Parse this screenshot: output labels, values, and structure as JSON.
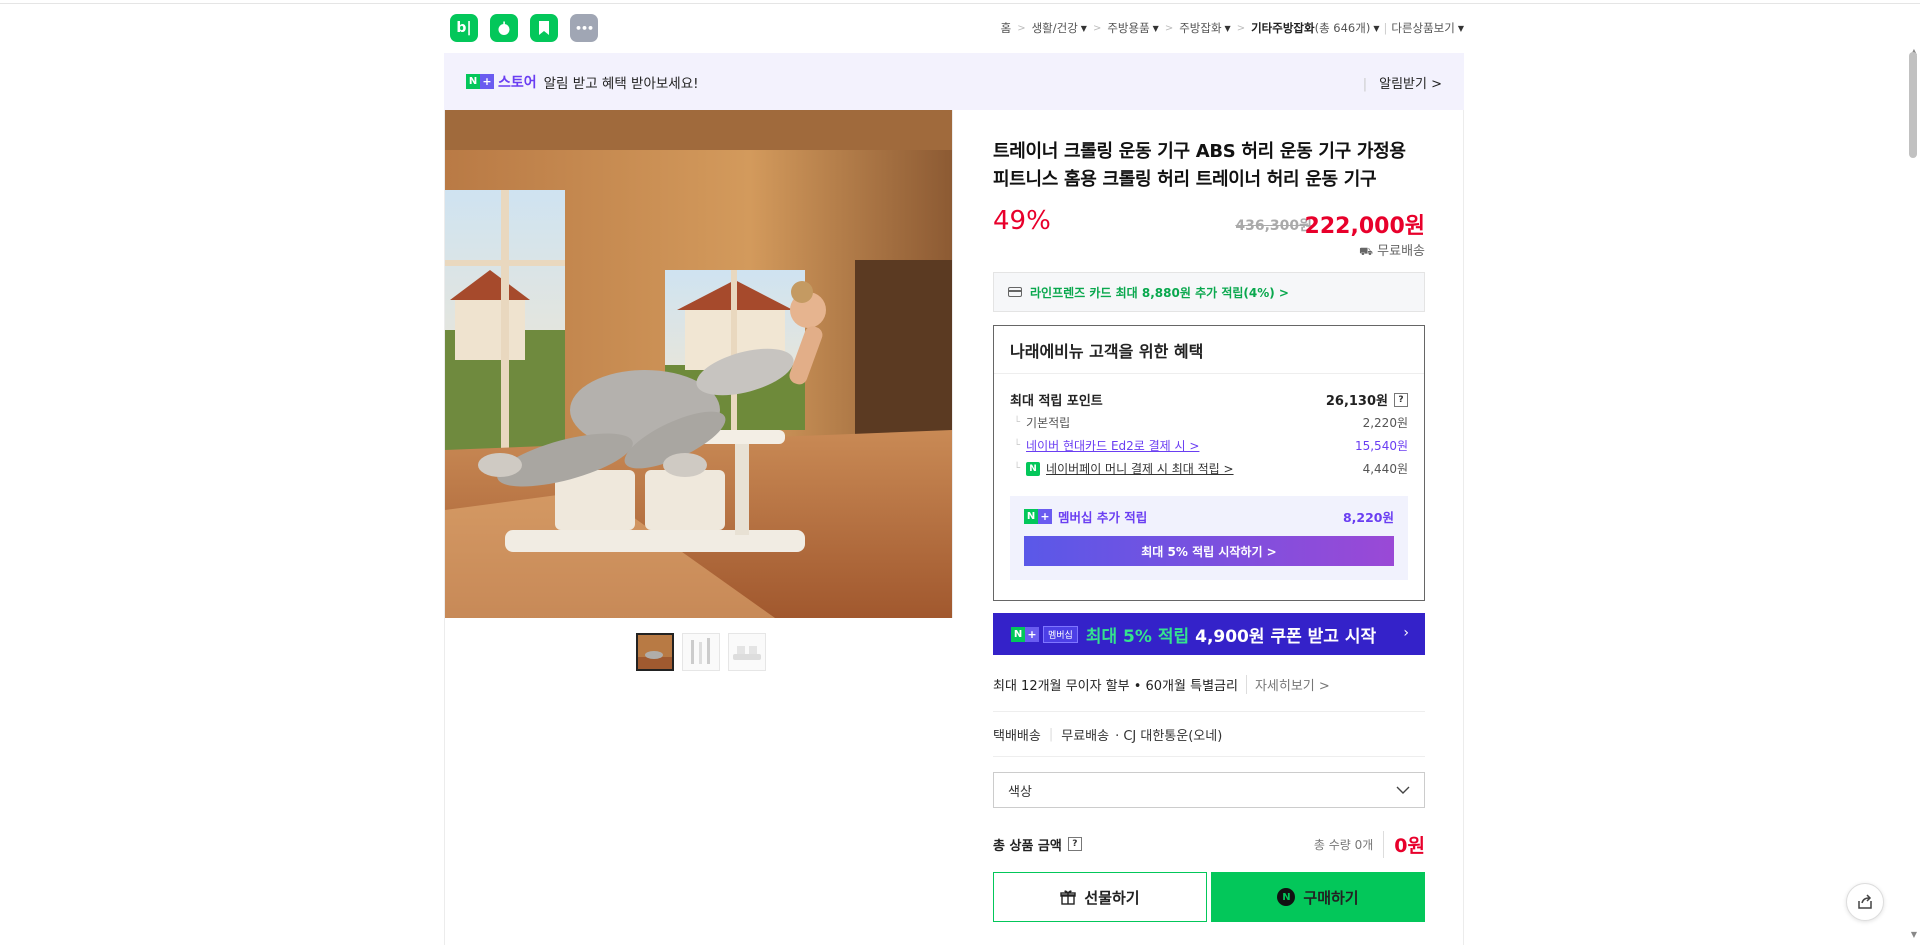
{
  "header": {
    "apps": [
      {
        "name": "blog-app-icon",
        "glyph": "b|"
      },
      {
        "name": "apple-app-icon",
        "glyph": "🍏"
      },
      {
        "name": "bookmark-app-icon",
        "glyph": "▰"
      },
      {
        "name": "more-app-icon",
        "glyph": "•••"
      }
    ],
    "breadcrumb": {
      "home": "홈",
      "level1": "생활/건강",
      "level2": "주방용품",
      "level3": "주방잡화",
      "level4": "기타주방잡화",
      "level4_count": "(총 646개)",
      "other": "다른상품보기"
    }
  },
  "store_banner": {
    "store_word": "스토어",
    "message": "알림 받고 혜택 받아보세요!",
    "alarm_label": "알림받기 >"
  },
  "product": {
    "title": "트레이너 크롤링 운동 기구 ABS 허리 운동 기구 가정용 피트니스 홈용 크롤링 허리 트레이너 허리 운동 기구",
    "discount": "49%",
    "original_price": "436,300원",
    "sale_price": "222,000원",
    "shipping": "무료배송",
    "card_benefit": "라인프렌즈 카드 최대 8,880원 추가 적립(4%) >"
  },
  "benefit": {
    "heading": "나래에비뉴 고객을 위한 혜택",
    "max_point_label": "최대 적립 포인트",
    "max_point_value": "26,130원",
    "rows": [
      {
        "label": "기본적립",
        "value": "2,220원"
      },
      {
        "label": "네이버 현대카드 Ed2로 결제 시 >",
        "value": "15,540원"
      },
      {
        "label": "네이버페이 머니 결제 시 최대 적립 >",
        "value": "4,440원"
      }
    ],
    "membership_label": "멤버십 추가 적립",
    "membership_value": "8,220원",
    "membership_button": "최대 5% 적립 시작하기 >"
  },
  "coupon": {
    "tag": "멤버십",
    "accent": "최대 5% 적립",
    "main": "4,900원 쿠폰 받고 시작",
    "arrow": "›"
  },
  "installment": {
    "text": "최대 12개월 무이자 할부 • 60개월 특별금리",
    "more": "자세히보기 >"
  },
  "delivery": {
    "type": "택배배송",
    "fee": "무료배송",
    "carrier": "· CJ 대한통운(오네)"
  },
  "option_select": {
    "placeholder": "색상"
  },
  "total": {
    "label": "총 상품 금액",
    "qty": "총 수량 0개",
    "amount": "0원"
  },
  "buttons": {
    "gift": "선물하기",
    "buy": "구매하기"
  },
  "colors": {
    "naver_green": "#03c75a",
    "sale_red": "#e8002b",
    "membership_purple": "#6a3ef2",
    "coupon_navy": "#3422c9"
  }
}
